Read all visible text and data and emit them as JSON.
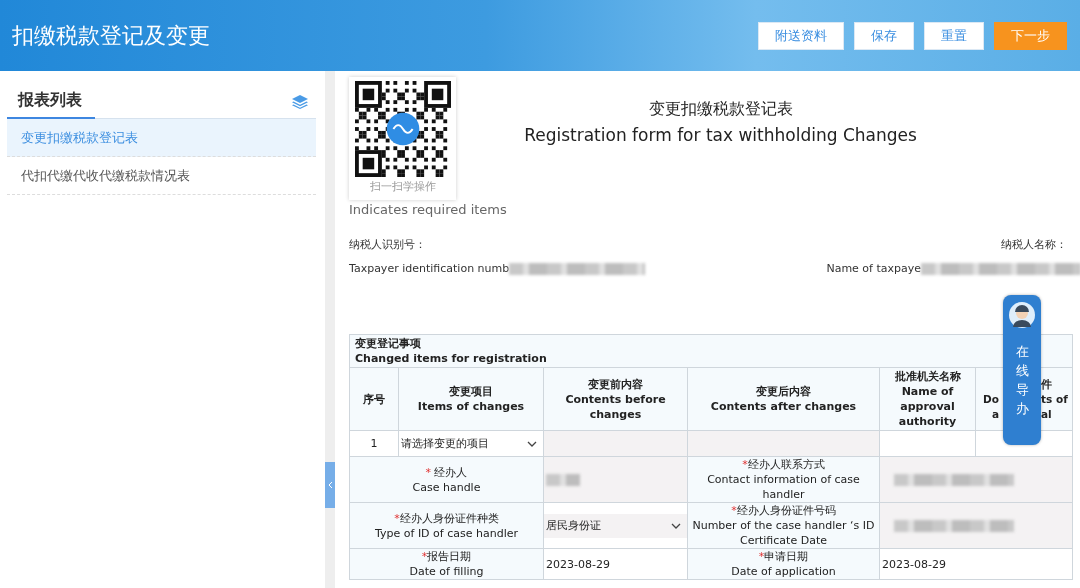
{
  "header": {
    "title": "扣缴税款登记及变更",
    "buttons": [
      {
        "label": "附送资料",
        "kind": "plain"
      },
      {
        "label": "保存",
        "kind": "plain"
      },
      {
        "label": "重置",
        "kind": "plain"
      },
      {
        "label": "下一步",
        "kind": "primary"
      }
    ]
  },
  "sidebar": {
    "title": "报表列表",
    "items": [
      {
        "label": "变更扣缴税款登记表",
        "selected": true
      },
      {
        "label": "代扣代缴代收代缴税款情况表",
        "selected": false
      }
    ]
  },
  "qr": {
    "caption": "扫一扫学操作"
  },
  "form": {
    "title_zh": "变更扣缴税款登记表",
    "title_en": "Registration form for tax withholding Changes",
    "required_note": "Indicates required items",
    "taxpayer_id": {
      "label_zh": "纳税人识别号：",
      "label_en": "Taxpayer identification numb"
    },
    "taxpayer_name": {
      "label_zh": "纳税人名称：",
      "label_en": "Name of taxpaye"
    }
  },
  "table": {
    "title_zh": "变更登记事项",
    "title_en": "Changed items for registration",
    "columns": [
      {
        "zh": "序号"
      },
      {
        "zh": "变更项目",
        "en": "Items of changes"
      },
      {
        "zh": "变更前内容",
        "en": "Contents before changes"
      },
      {
        "zh": "变更后内容",
        "en": "Contents after changes"
      },
      {
        "zh": "批准机关名称",
        "en": "Name of approval authority"
      },
      {
        "left": [
          "Do",
          "a"
        ],
        "right": [
          "件",
          "ts of",
          "al"
        ]
      }
    ],
    "rows": [
      {
        "index": "1",
        "item": "请选择变更的项目"
      }
    ],
    "fields": [
      {
        "required_mark": "*",
        "label_zh": " 经办人",
        "label_en": "Case handle",
        "kind": "blurred"
      },
      {
        "required_mark": "*",
        "label_zh": "经办人联系方式",
        "label_en": "Contact information of case handler",
        "kind": "blurred"
      },
      {
        "required_mark": "*",
        "label_zh": "经办人身份证件种类",
        "label_en": "Type of ID of case handler",
        "kind": "select",
        "value": "居民身份证"
      },
      {
        "required_mark": "*",
        "label_zh": "经办人身份证件号码",
        "label_en": "Number of the case handler ‘s ID Certificate Date",
        "kind": "blurred"
      },
      {
        "required_mark": "*",
        "label_zh": "报告日期",
        "label_en": "Date of filling",
        "kind": "text",
        "value": "2023-08-29"
      },
      {
        "required_mark": "*",
        "label_zh": "申请日期",
        "label_en": "Date of application",
        "kind": "text",
        "value": "2023-08-29"
      }
    ]
  },
  "assistant": {
    "label": "在线导办"
  }
}
